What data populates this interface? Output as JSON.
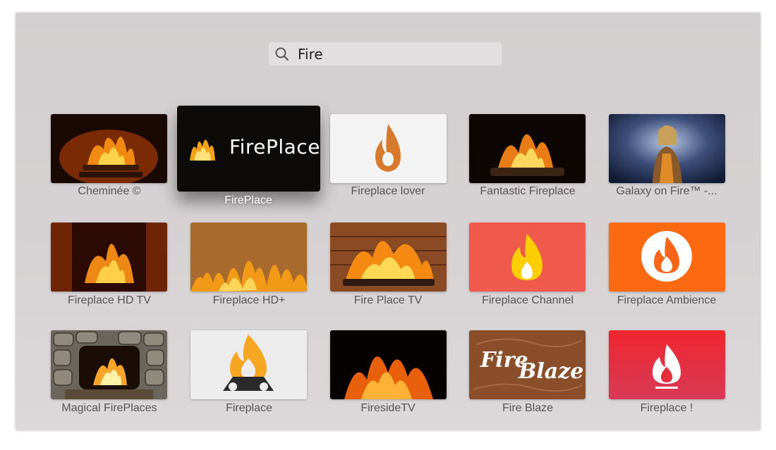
{
  "search": {
    "query": "Fire",
    "icon": "search-icon"
  },
  "results": [
    {
      "label": "Cheminée ©",
      "art": "cheminee"
    },
    {
      "label": "FirePlace",
      "art": "fireplace-dark",
      "focused": true,
      "logo_text": "FirePlace"
    },
    {
      "label": "Fireplace lover",
      "art": "drop-flame"
    },
    {
      "label": "Fantastic Fireplace",
      "art": "logs-fire"
    },
    {
      "label": "Galaxy on Fire™ -...",
      "art": "galaxy"
    },
    {
      "label": "Fireplace HD TV",
      "art": "hd-fire"
    },
    {
      "label": "Fireplace HD+",
      "art": "hd-plus"
    },
    {
      "label": "Fire Place TV",
      "art": "brick-fire"
    },
    {
      "label": "Fireplace Channel",
      "art": "channel-flame"
    },
    {
      "label": "Fireplace Ambience",
      "art": "ambience"
    },
    {
      "label": "Magical FirePlaces",
      "art": "stone-fire"
    },
    {
      "label": "Fireplace",
      "art": "campfire"
    },
    {
      "label": "FiresideTV",
      "art": "fireside"
    },
    {
      "label": "Fire Blaze",
      "art": "blaze",
      "logo_text": "FireBlaze"
    },
    {
      "label": "Fireplace !",
      "art": "red-flame"
    }
  ],
  "colors": {
    "background": "#d5d1d2",
    "label": "#555555",
    "focused_label": "#ffffff",
    "channel_red": "#ef5a4c",
    "ambience_orange": "#fb6a10",
    "red_app": "#e5323f"
  }
}
